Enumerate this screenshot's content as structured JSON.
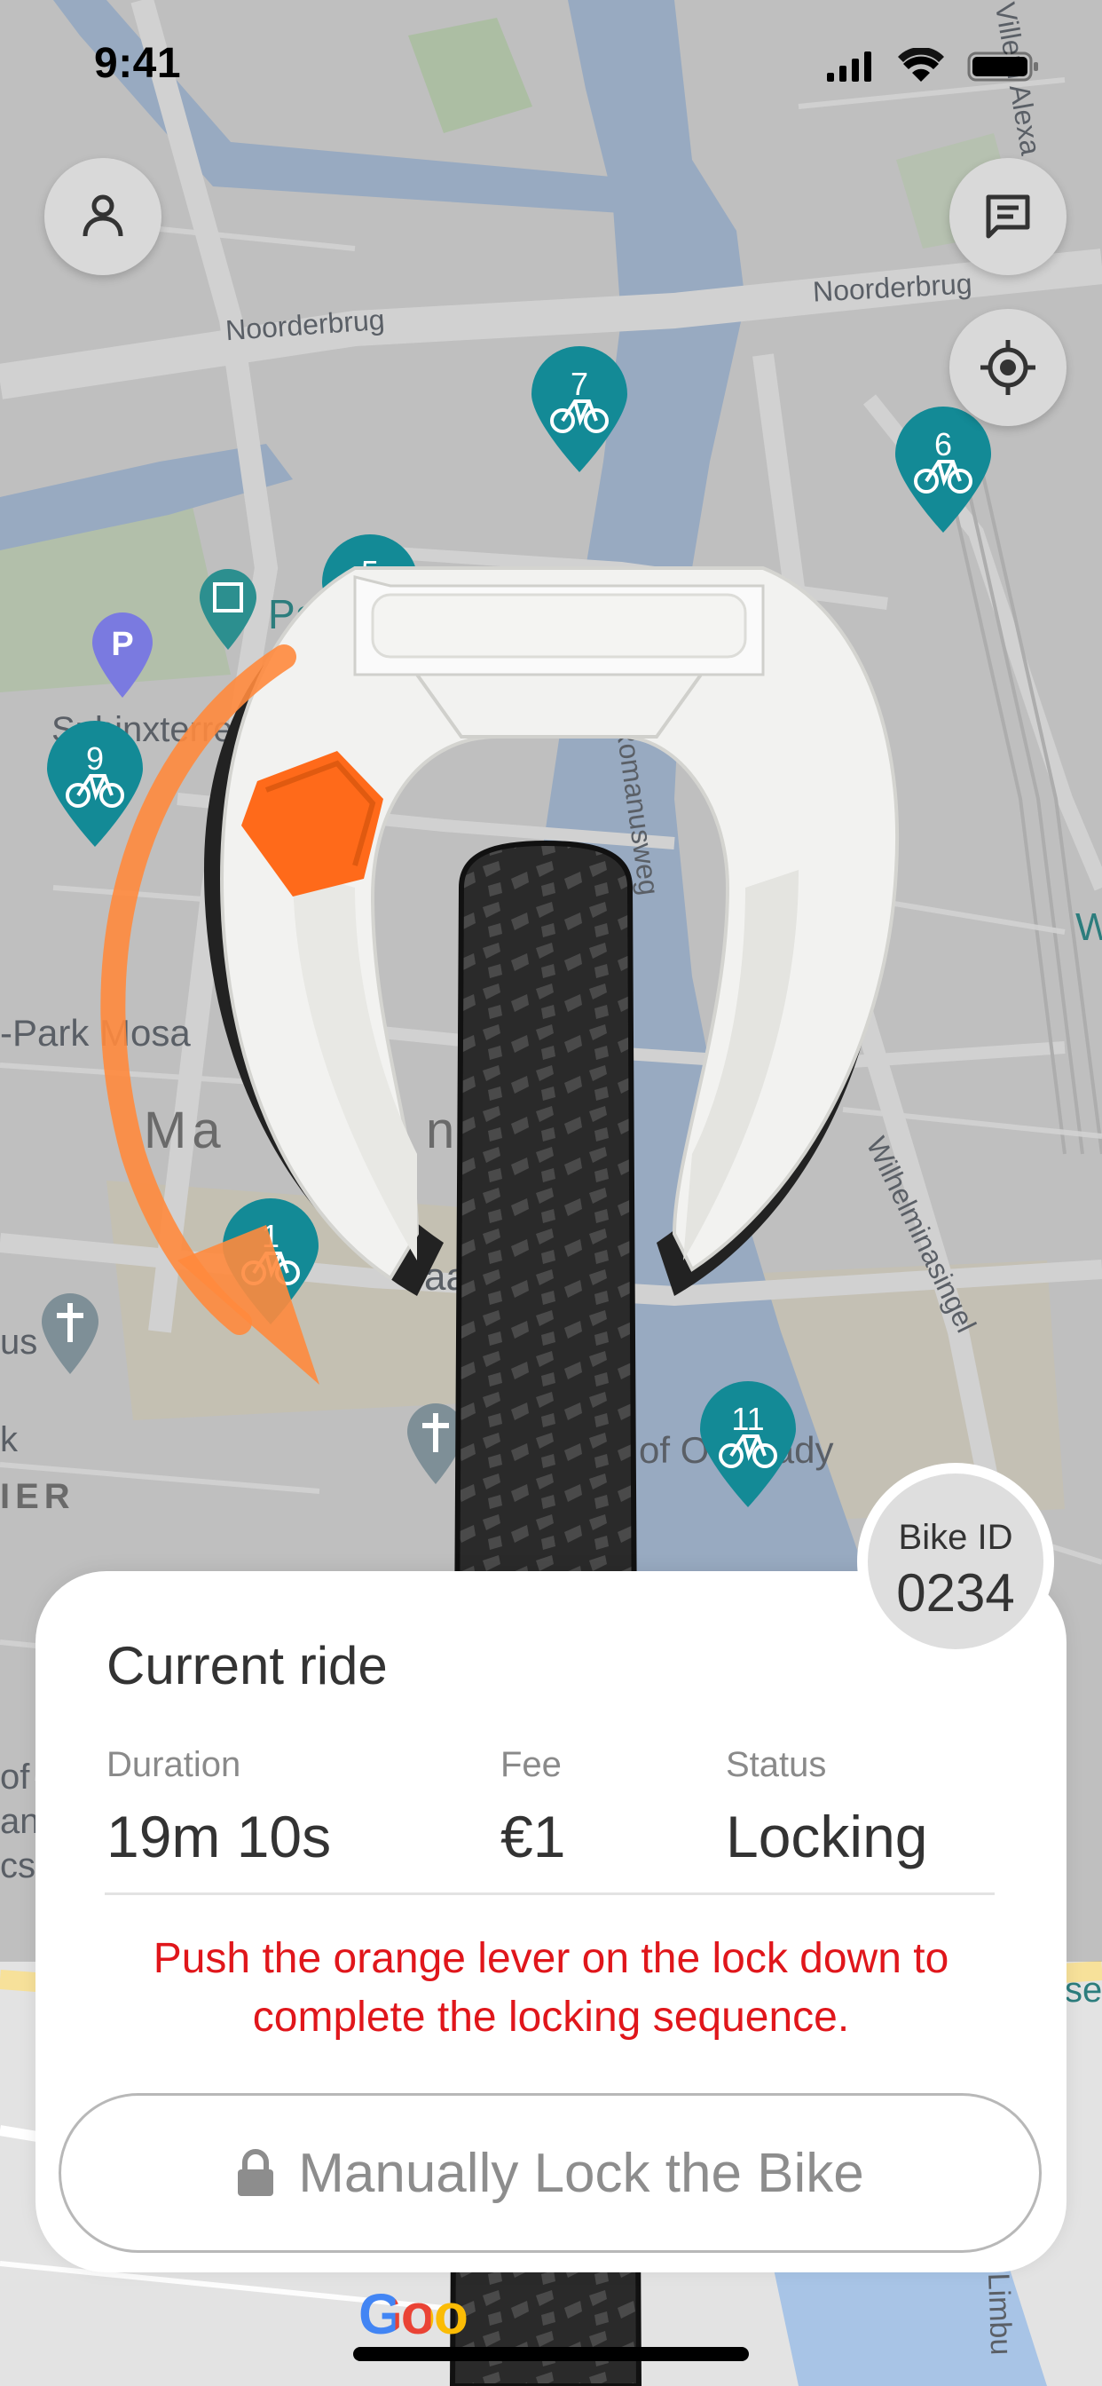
{
  "status_bar": {
    "time": "9:41",
    "icons": [
      "signal-icon",
      "wifi-icon",
      "battery-icon"
    ]
  },
  "map": {
    "labels": {
      "noorderbrug_left": "Noorderbrug",
      "noorderbrug_right": "Noorderbrug",
      "franciscus": "Franciscus Romanusweg",
      "wilhelminasingel": "Wilhelminasingel",
      "pa": "Pa",
      "sphinx": "Sphinxterrein",
      "park_mosa": "-Park Mosa",
      "ma": "Ma",
      "nt": "nt",
      "us": "us",
      "k": "k",
      "ier": "IER",
      "of_our_lady": "of Our Lady",
      "of": "of",
      "an": "an",
      "cs": "cs",
      "ser": "sei",
      "aa": "aa",
      "villem": "Villem Alexa",
      "w": "W",
      "limbu": "Limbu"
    },
    "pins": [
      {
        "id": "pin-7",
        "number": "7"
      },
      {
        "id": "pin-6",
        "number": "6"
      },
      {
        "id": "pin-5",
        "number": "5"
      },
      {
        "id": "pin-9",
        "number": "9"
      },
      {
        "id": "pin-1",
        "number": "1"
      },
      {
        "id": "pin-11",
        "number": "11"
      }
    ],
    "google_logo": "Goo"
  },
  "bike": {
    "id_label": "Bike ID",
    "id_value": "0234"
  },
  "ride": {
    "title": "Current ride",
    "stats": [
      {
        "label": "Duration",
        "value": "19m 10s"
      },
      {
        "label": "Fee",
        "value": "€1"
      },
      {
        "label": "Status",
        "value": "Locking"
      }
    ],
    "instruction": "Push the orange lever on the lock down to complete the locking sequence.",
    "manual_lock_label": "Manually Lock the Bike"
  },
  "colors": {
    "pin": "#138a96",
    "alert_text": "#e0161b",
    "arrow": "#ff8a3d",
    "lever": "#ff6a1a",
    "river": "#a8c4e6"
  },
  "icons": {
    "profile": "person-icon",
    "messages": "chat-icon",
    "locate": "crosshair-icon",
    "lock": "padlock-icon"
  }
}
